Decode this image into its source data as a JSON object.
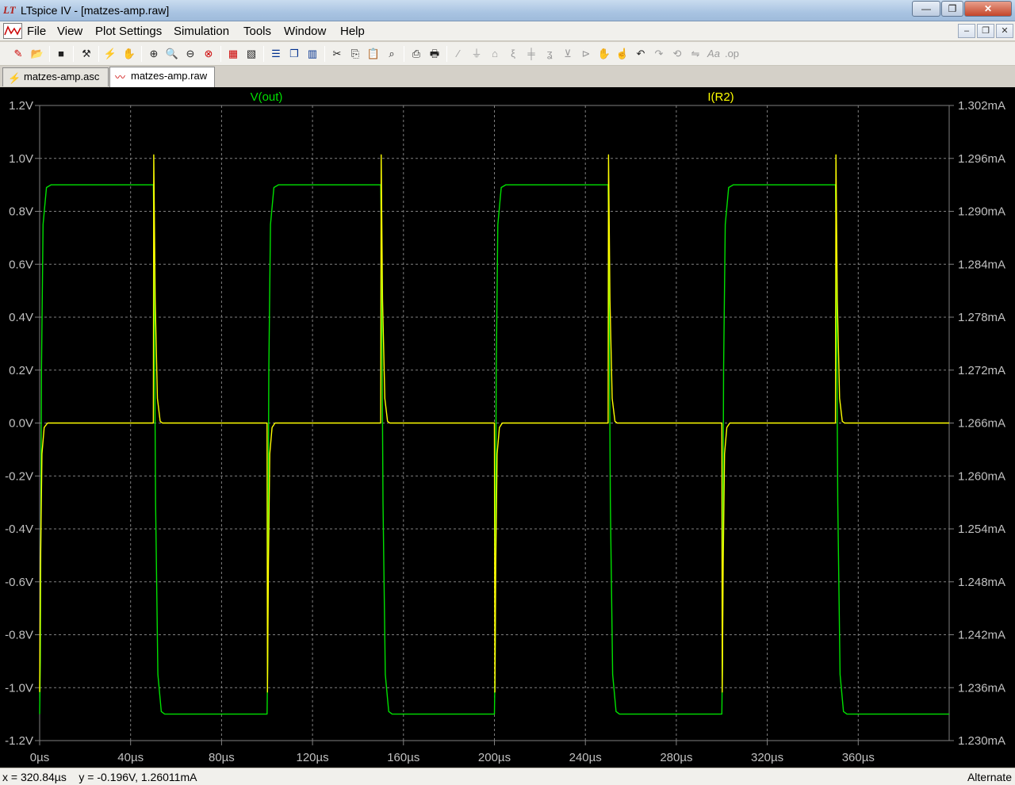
{
  "window": {
    "title": "LTspice IV - [matzes-amp.raw]",
    "buttons": {
      "minimize": "—",
      "restore": "❐",
      "close": "✕"
    }
  },
  "menu": {
    "items": [
      {
        "label": "File",
        "key": "F"
      },
      {
        "label": "View",
        "key": "V"
      },
      {
        "label": "Plot Settings",
        "key": "P"
      },
      {
        "label": "Simulation",
        "key": "S"
      },
      {
        "label": "Tools",
        "key": "T"
      },
      {
        "label": "Window",
        "key": "W"
      },
      {
        "label": "Help",
        "key": "H"
      }
    ],
    "mdi_buttons": [
      "–",
      "❐",
      "✕"
    ]
  },
  "toolbar": {
    "icons": [
      "new-schematic",
      "open",
      "save",
      "control-panel",
      "run",
      "pan",
      "zoom-in",
      "zoom-area",
      "zoom-out",
      "zoom-cancel",
      "autorange",
      "plot-settings",
      "tile-horizontal",
      "cascade",
      "tile-vertical",
      "cut",
      "copy",
      "paste",
      "find",
      "print-preview",
      "print",
      "wire",
      "ground",
      "label-net",
      "resistor",
      "capacitor",
      "inductor",
      "diode",
      "component",
      "move",
      "drag",
      "undo",
      "redo",
      "rotate",
      "mirror",
      "text",
      "spice-directive"
    ]
  },
  "tabs": [
    {
      "label": "matzes-amp.asc",
      "icon": "schematic-icon",
      "active": false
    },
    {
      "label": "matzes-amp.raw",
      "icon": "waveform-icon",
      "active": true
    }
  ],
  "status": {
    "readout": "x = 320.84µs    y = -0.196V, 1.26011mA",
    "mode": "Alternate"
  },
  "chart_data": {
    "type": "line",
    "background": "#000000",
    "grid": true,
    "grid_color": "#808080",
    "x_axis": {
      "ticks": [
        "0µs",
        "40µs",
        "80µs",
        "120µs",
        "160µs",
        "200µs",
        "240µs",
        "280µs",
        "320µs",
        "360µs"
      ],
      "range": [
        0,
        400
      ],
      "unit": "µs"
    },
    "y_left": {
      "ticks": [
        "1.2V",
        "1.0V",
        "0.8V",
        "0.6V",
        "0.4V",
        "0.2V",
        "0.0V",
        "-0.2V",
        "-0.4V",
        "-0.6V",
        "-0.8V",
        "-1.0V",
        "-1.2V"
      ],
      "range": [
        -1.2,
        1.2
      ],
      "unit": "V"
    },
    "y_right": {
      "ticks": [
        "1.302mA",
        "1.296mA",
        "1.290mA",
        "1.284mA",
        "1.278mA",
        "1.272mA",
        "1.266mA",
        "1.260mA",
        "1.254mA",
        "1.248mA",
        "1.242mA",
        "1.236mA",
        "1.230mA"
      ],
      "range": [
        1.23,
        1.302
      ],
      "unit": "mA"
    },
    "series": [
      {
        "name": "V(out)",
        "color": "#00e000",
        "axis": "left",
        "description": "square wave, period 100µs",
        "high": 0.9,
        "low": -1.1,
        "points": [
          [
            0,
            -1.1
          ],
          [
            0.3,
            -0.9
          ],
          [
            0.8,
            0.2
          ],
          [
            1.5,
            0.75
          ],
          [
            3,
            0.89
          ],
          [
            5,
            0.9
          ],
          [
            50,
            0.9
          ],
          [
            50.3,
            0.7
          ],
          [
            51,
            -0.3
          ],
          [
            52,
            -0.95
          ],
          [
            53.5,
            -1.09
          ],
          [
            55,
            -1.1
          ],
          [
            100,
            -1.1
          ],
          [
            100.3,
            -0.9
          ],
          [
            100.8,
            0.2
          ],
          [
            101.5,
            0.75
          ],
          [
            103,
            0.89
          ],
          [
            105,
            0.9
          ],
          [
            150,
            0.9
          ],
          [
            150.3,
            0.7
          ],
          [
            151,
            -0.3
          ],
          [
            152,
            -0.95
          ],
          [
            153.5,
            -1.09
          ],
          [
            155,
            -1.1
          ],
          [
            200,
            -1.1
          ],
          [
            200.3,
            -0.9
          ],
          [
            200.8,
            0.2
          ],
          [
            201.5,
            0.75
          ],
          [
            203,
            0.89
          ],
          [
            205,
            0.9
          ],
          [
            250,
            0.9
          ],
          [
            250.3,
            0.7
          ],
          [
            251,
            -0.3
          ],
          [
            252,
            -0.95
          ],
          [
            253.5,
            -1.09
          ],
          [
            255,
            -1.1
          ],
          [
            300,
            -1.1
          ],
          [
            300.3,
            -0.9
          ],
          [
            300.8,
            0.2
          ],
          [
            301.5,
            0.75
          ],
          [
            303,
            0.89
          ],
          [
            305,
            0.9
          ],
          [
            350,
            0.9
          ],
          [
            350.3,
            0.7
          ],
          [
            351,
            -0.3
          ],
          [
            352,
            -0.95
          ],
          [
            353.5,
            -1.09
          ],
          [
            355,
            -1.1
          ],
          [
            400,
            -1.1
          ]
        ]
      },
      {
        "name": "I(R2)",
        "color": "#ffff00",
        "axis": "right",
        "description": "flat at ~1.2660mA with alternating spikes at edges",
        "points": [
          [
            0,
            1.2355
          ],
          [
            0.4,
            1.25
          ],
          [
            1,
            1.2625
          ],
          [
            2,
            1.2655
          ],
          [
            3.5,
            1.266
          ],
          [
            50,
            1.266
          ],
          [
            50.2,
            1.2964
          ],
          [
            50.8,
            1.28
          ],
          [
            51.8,
            1.2688
          ],
          [
            53,
            1.2662
          ],
          [
            54,
            1.266
          ],
          [
            100,
            1.266
          ],
          [
            100.2,
            1.2355
          ],
          [
            100.6,
            1.25
          ],
          [
            101.2,
            1.2625
          ],
          [
            102.2,
            1.2655
          ],
          [
            103.5,
            1.266
          ],
          [
            150,
            1.266
          ],
          [
            150.2,
            1.2964
          ],
          [
            150.8,
            1.28
          ],
          [
            151.8,
            1.2688
          ],
          [
            153,
            1.2662
          ],
          [
            154,
            1.266
          ],
          [
            200,
            1.266
          ],
          [
            200.2,
            1.2355
          ],
          [
            200.6,
            1.25
          ],
          [
            201.2,
            1.2625
          ],
          [
            202.2,
            1.2655
          ],
          [
            203.5,
            1.266
          ],
          [
            250,
            1.266
          ],
          [
            250.2,
            1.2964
          ],
          [
            250.8,
            1.28
          ],
          [
            251.8,
            1.2688
          ],
          [
            253,
            1.2662
          ],
          [
            254,
            1.266
          ],
          [
            300,
            1.266
          ],
          [
            300.2,
            1.2355
          ],
          [
            300.6,
            1.25
          ],
          [
            301.2,
            1.2625
          ],
          [
            302.2,
            1.2655
          ],
          [
            303.5,
            1.266
          ],
          [
            350,
            1.266
          ],
          [
            350.2,
            1.2964
          ],
          [
            350.8,
            1.28
          ],
          [
            351.8,
            1.2688
          ],
          [
            353,
            1.2662
          ],
          [
            354,
            1.266
          ],
          [
            400,
            1.266
          ]
        ]
      }
    ]
  }
}
